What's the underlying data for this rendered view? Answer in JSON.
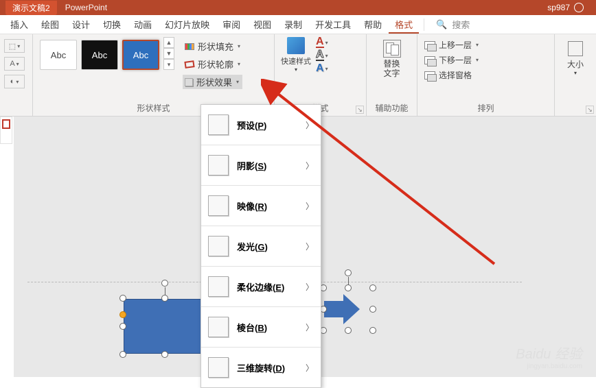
{
  "titlebar": {
    "doc": "演示文稿2",
    "app": "PowerPoint",
    "user": "sp987"
  },
  "tabs": {
    "items": [
      "插入",
      "绘图",
      "设计",
      "切换",
      "动画",
      "幻灯片放映",
      "审阅",
      "视图",
      "录制",
      "开发工具",
      "帮助"
    ],
    "active": "格式",
    "search": "搜索"
  },
  "ribbon": {
    "styles": {
      "swatch_label": "Abc",
      "fill": "形状填充",
      "outline": "形状轮廓",
      "effects": "形状效果",
      "group_label": "形状样式"
    },
    "wordart": {
      "quick": "快速样式",
      "group_label": "样式"
    },
    "alt": {
      "line1": "替换",
      "line2": "文字",
      "group_label": "辅助功能"
    },
    "arrange": {
      "forward": "上移一层",
      "backward": "下移一层",
      "pane": "选择窗格",
      "group_label": "排列"
    },
    "size": {
      "label": "大小"
    }
  },
  "dropdown": {
    "items": [
      {
        "label": "预设",
        "key": "P"
      },
      {
        "label": "阴影",
        "key": "S"
      },
      {
        "label": "映像",
        "key": "R"
      },
      {
        "label": "发光",
        "key": "G"
      },
      {
        "label": "柔化边缘",
        "key": "E"
      },
      {
        "label": "棱台",
        "key": "B"
      },
      {
        "label": "三维旋转",
        "key": "D"
      }
    ]
  },
  "watermark": {
    "main": "Baidu 经验",
    "sub": "jingyan.baidu.com"
  }
}
